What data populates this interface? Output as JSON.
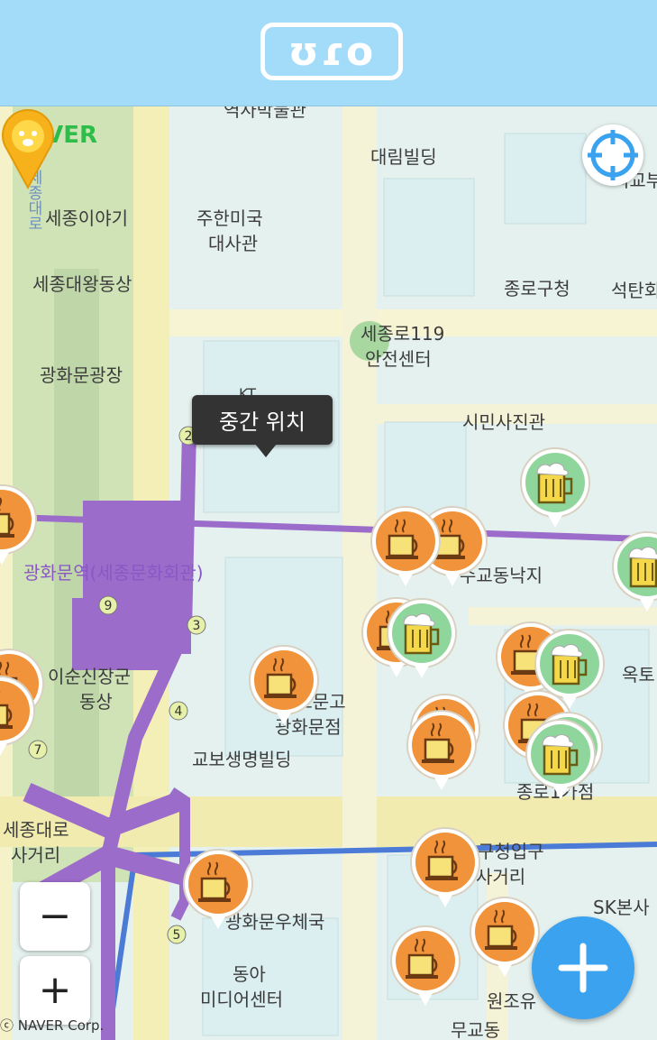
{
  "header": {
    "logo_text": "ʊɾo"
  },
  "map": {
    "provider_logo": "NAVER",
    "copyright": "ⓒ NAVER Corp.",
    "tooltip": "중간 위치",
    "labels": {
      "museum": "역사박물관",
      "daerim": "대림빌딩",
      "sejong_story": "세종이야기",
      "us_embassy_1": "주한미국",
      "us_embassy_2": "대사관",
      "sejong_statue": "세종대왕동상",
      "jongno_office": "종로구청",
      "seoktan": "석탄회",
      "safety_1": "세종로119",
      "safety_2": "안전센터",
      "gwanghwamun_plaza": "광화문광장",
      "kt": "KT",
      "photo_hall": "시민사진관",
      "station": "광화문역(세종문화회관)",
      "sugyo": "수교동낙지",
      "yisunsin_1": "이순신장군",
      "yisunsin_2": "동상",
      "kyobo_1": "교보문고",
      "kyobo_2": "광화문점",
      "kyobo_bldg": "교보생명빌딩",
      "jongno_street": "종로1가점",
      "okto": "옥토",
      "sejongno_crossing_1": "세종대로",
      "sejongno_crossing_2": "사거리",
      "gucheong_1": "구청입구",
      "gucheong_2": "사거리",
      "sk": "SK본사",
      "post_office": "광화문우체국",
      "donga_1": "동아",
      "donga_2": "미디어센터",
      "wonjo": "원조유",
      "mugyo": "무교동",
      "sejong_road": "세종대로",
      "oegyo": "외교부",
      "gwanghwamun_area": "광화문"
    },
    "exits": [
      "2",
      "9",
      "3",
      "4",
      "7",
      "5"
    ],
    "zoom_out_label": "−",
    "zoom_in_label": "+"
  },
  "colors": {
    "header": "#a2dcf8",
    "subway_line5": "#9b6cc9",
    "cafe_pin": "#f0933a",
    "beer_pin": "#8fd69c",
    "midpoint_pin": "#f7b21b",
    "fab": "#3aa2ee"
  },
  "icons": {
    "cafe": "coffee-cup-icon",
    "beer": "beer-mug-icon",
    "locate": "crosshair-icon",
    "fab": "plus-icon",
    "midpoint": "face-pin-icon"
  }
}
